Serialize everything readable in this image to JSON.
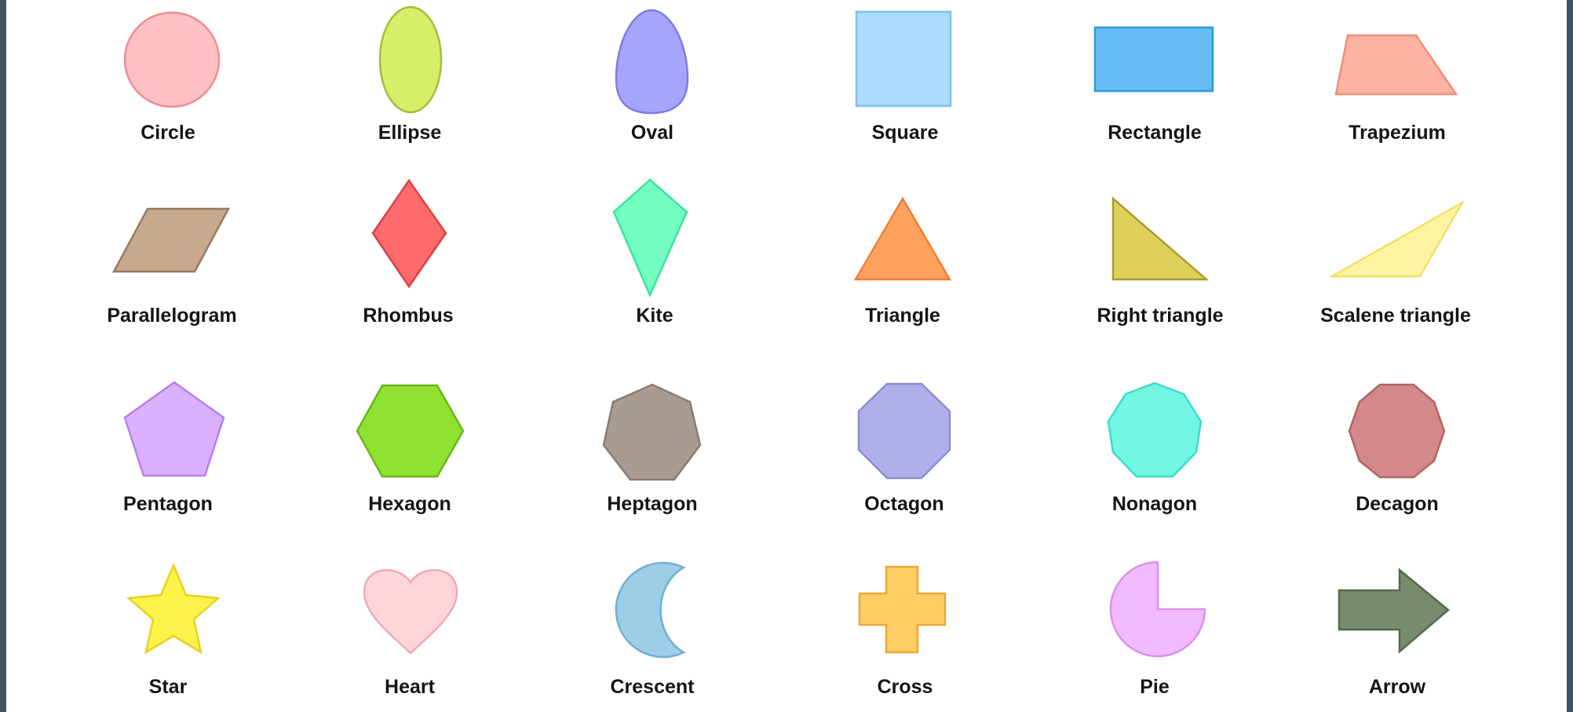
{
  "shapes": [
    {
      "id": "circle",
      "label": "Circle",
      "fill": "#ffc1c4",
      "stroke": "#ee8c92"
    },
    {
      "id": "ellipse",
      "label": "Ellipse",
      "fill": "#d5ef68",
      "stroke": "#a4bd3c"
    },
    {
      "id": "oval",
      "label": "Oval",
      "fill": "#a6a5fc",
      "stroke": "#7d7ce0"
    },
    {
      "id": "square",
      "label": "Square",
      "fill": "#abdcfd",
      "stroke": "#79c2ef"
    },
    {
      "id": "rectangle",
      "label": "Rectangle",
      "fill": "#66bdf4",
      "stroke": "#2b9bd6"
    },
    {
      "id": "trapezium",
      "label": "Trapezium",
      "fill": "#ffb3a1",
      "stroke": "#ee8f7c"
    },
    {
      "id": "parallelogram",
      "label": "Parallelogram",
      "fill": "#c7a98d",
      "stroke": "#957a62"
    },
    {
      "id": "rhombus",
      "label": "Rhombus",
      "fill": "#ff6a6c",
      "stroke": "#d84345"
    },
    {
      "id": "kite",
      "label": "Kite",
      "fill": "#73fdc1",
      "stroke": "#3fe2a0"
    },
    {
      "id": "triangle",
      "label": "Triangle",
      "fill": "#ffa260",
      "stroke": "#ef7e36"
    },
    {
      "id": "right-triangle",
      "label": "Right triangle",
      "fill": "#dfd05a",
      "stroke": "#a99a33"
    },
    {
      "id": "scalene-triangle",
      "label": "Scalene triangle",
      "fill": "#fdf4a1",
      "stroke": "#f0e167"
    },
    {
      "id": "pentagon",
      "label": "Pentagon",
      "fill": "#dab1ff",
      "stroke": "#b77ee9"
    },
    {
      "id": "hexagon",
      "label": "Hexagon",
      "fill": "#8fe132",
      "stroke": "#6bb51b"
    },
    {
      "id": "heptagon",
      "label": "Heptagon",
      "fill": "#aa9b90",
      "stroke": "#8a7b70"
    },
    {
      "id": "octagon",
      "label": "Octagon",
      "fill": "#afb0ea",
      "stroke": "#8b8cd3"
    },
    {
      "id": "nonagon",
      "label": "Nonagon",
      "fill": "#72f7e5",
      "stroke": "#3edbc8"
    },
    {
      "id": "decagon",
      "label": "Decagon",
      "fill": "#d38989",
      "stroke": "#b06464"
    },
    {
      "id": "star",
      "label": "Star",
      "fill": "#fff24a",
      "stroke": "#e6d21e"
    },
    {
      "id": "heart",
      "label": "Heart",
      "fill": "#ffd5da",
      "stroke": "#f1a9b4"
    },
    {
      "id": "crescent",
      "label": "Crescent",
      "fill": "#9ecde6",
      "stroke": "#6fb0d3"
    },
    {
      "id": "cross",
      "label": "Cross",
      "fill": "#fecd63",
      "stroke": "#e9a935"
    },
    {
      "id": "pie",
      "label": "Pie",
      "fill": "#f1baff",
      "stroke": "#d891ea"
    },
    {
      "id": "arrow",
      "label": "Arrow",
      "fill": "#768c6c",
      "stroke": "#556a4d"
    }
  ]
}
